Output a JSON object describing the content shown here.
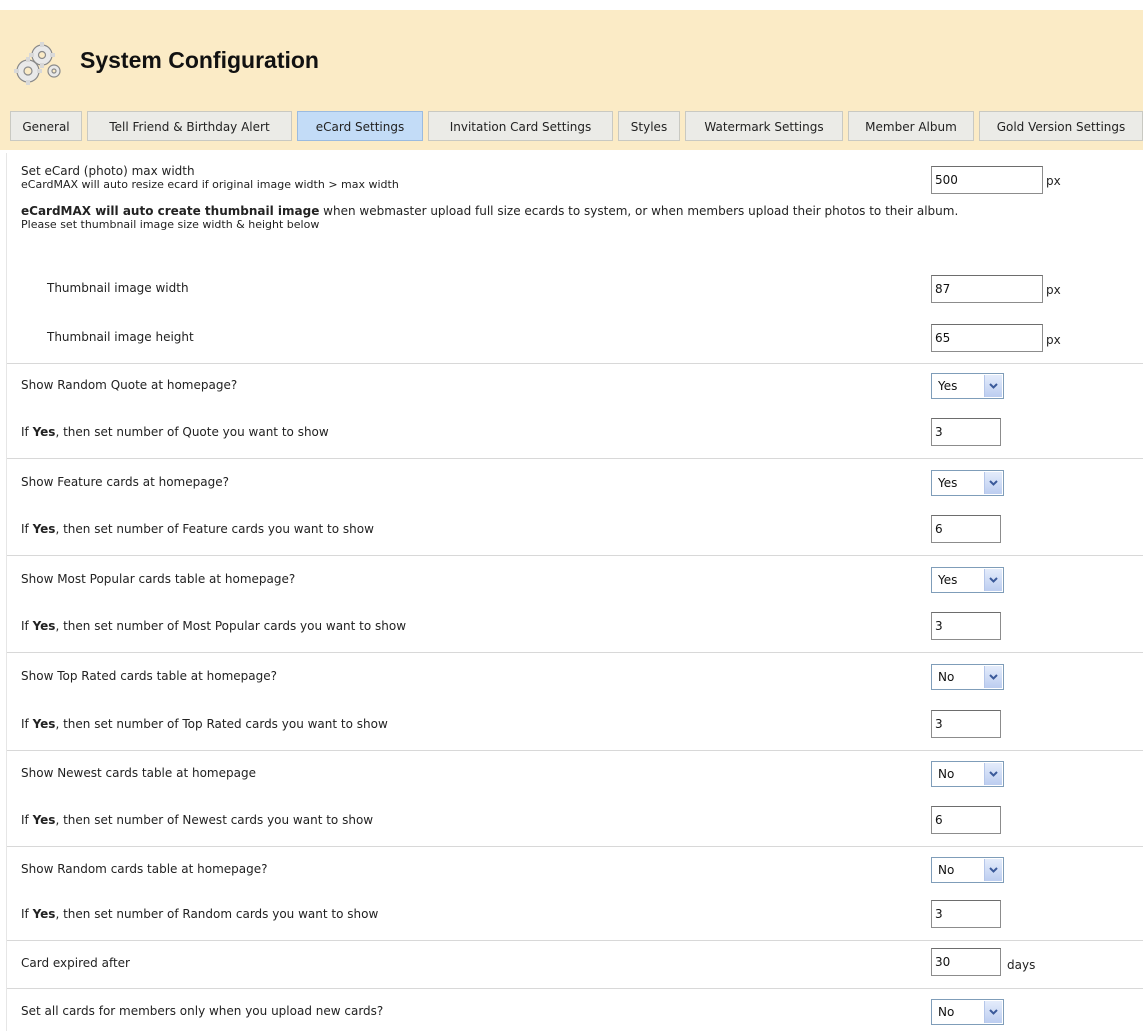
{
  "header": {
    "title": "System Configuration"
  },
  "tabs": [
    {
      "label": "General"
    },
    {
      "label": "Tell Friend & Birthday Alert"
    },
    {
      "label": "eCard Settings"
    },
    {
      "label": "Invitation Card Settings"
    },
    {
      "label": "Styles"
    },
    {
      "label": "Watermark Settings"
    },
    {
      "label": "Member Album"
    },
    {
      "label": "Gold Version Settings"
    }
  ],
  "active_tab": "eCard Settings",
  "ecard": {
    "max_width_title": "Set eCard (photo) max width",
    "max_width_desc": "eCardMAX will auto resize ecard if original image width > max width",
    "max_width_value": "500",
    "unit_px": "px",
    "thumb_info_bold": "eCardMAX will auto create thumbnail image",
    "thumb_info_rest": " when webmaster upload full size ecards to system, or when members upload their photos to their album.",
    "thumb_info_line2": "Please set thumbnail image size width & height below",
    "thumb_width_label": "Thumbnail image width",
    "thumb_width_value": "87",
    "thumb_height_label": "Thumbnail image height",
    "thumb_height_value": "65"
  },
  "if_prefix": "If ",
  "yes_word": "Yes",
  "q_random_quote": "Show Random Quote at homepage?",
  "q_random_quote_value": "Yes",
  "n_random_quote": ", then set number of Quote you want to show",
  "n_random_quote_value": "3",
  "q_feature": "Show Feature cards at homepage?",
  "q_feature_value": "Yes",
  "n_feature": ", then set number of Feature cards you want to show",
  "n_feature_value": "6",
  "q_popular": "Show Most Popular cards table at homepage?",
  "q_popular_value": "Yes",
  "n_popular": ", then set number of Most Popular cards you want to show",
  "n_popular_value": "3",
  "q_toprated": "Show Top Rated cards table at homepage?",
  "q_toprated_value": "No",
  "n_toprated": ", then set number of Top Rated cards you want to show",
  "n_toprated_value": "3",
  "q_newest": "Show Newest cards table at homepage",
  "q_newest_value": "No",
  "n_newest": ", then set number of Newest cards you want to show",
  "n_newest_value": "6",
  "q_random_cards": "Show Random cards table at homepage?",
  "q_random_cards_value": "No",
  "n_random_cards": ", then set number of Random cards you want to show",
  "n_random_cards_value": "3",
  "expired_label": "Card expired after",
  "expired_value": "30",
  "expired_unit": "days",
  "members_only_label": "Set all cards for members only when you upload new cards?",
  "members_only_value": "No",
  "colors": {
    "header_bg": "#fbebc6",
    "active_tab_bg": "#c3dcf7",
    "tab_bg": "#ebebe7"
  },
  "icons": {
    "header": "gears-icon",
    "dropdown": "chevron-down-icon"
  }
}
